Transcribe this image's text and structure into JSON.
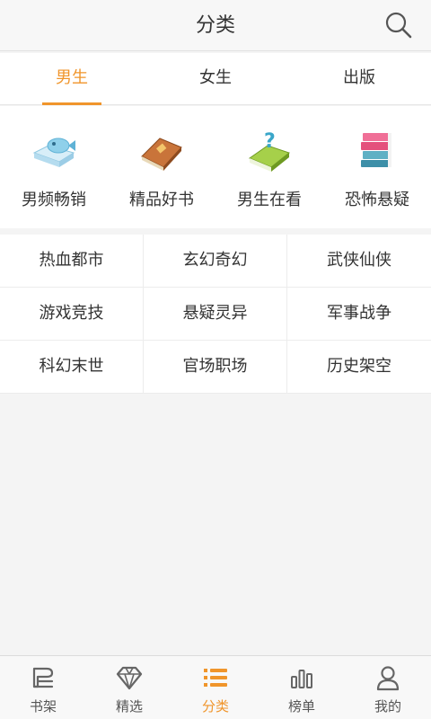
{
  "header": {
    "title": "分类",
    "search_icon": "search-icon"
  },
  "tabs": [
    {
      "label": "男生",
      "active": true
    },
    {
      "label": "女生",
      "active": false
    },
    {
      "label": "出版",
      "active": false
    }
  ],
  "features": [
    {
      "label": "男频畅销",
      "icon": "book-fish-icon"
    },
    {
      "label": "精品好书",
      "icon": "brown-book-icon"
    },
    {
      "label": "男生在看",
      "icon": "book-question-icon"
    },
    {
      "label": "恐怖悬疑",
      "icon": "book-stack-icon"
    }
  ],
  "categories": [
    [
      "热血都市",
      "玄幻奇幻",
      "武侠仙侠"
    ],
    [
      "游戏竞技",
      "悬疑灵异",
      "军事战争"
    ],
    [
      "科幻末世",
      "官场职场",
      "历史架空"
    ]
  ],
  "tabbar": [
    {
      "label": "书架",
      "icon": "bookshelf-icon",
      "active": false
    },
    {
      "label": "精选",
      "icon": "diamond-icon",
      "active": false
    },
    {
      "label": "分类",
      "icon": "list-icon",
      "active": true
    },
    {
      "label": "榜单",
      "icon": "bar-chart-icon",
      "active": false
    },
    {
      "label": "我的",
      "icon": "user-icon",
      "active": false
    }
  ],
  "colors": {
    "accent": "#f0952b",
    "text": "#333333",
    "background": "#f4f4f4"
  }
}
